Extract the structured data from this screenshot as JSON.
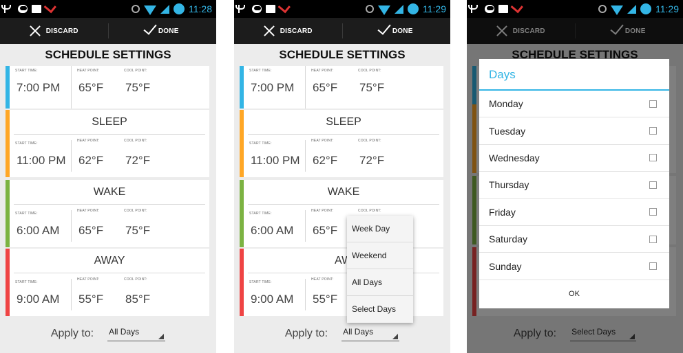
{
  "status": {
    "time1": "11:28",
    "time2": "11:29",
    "time3": "11:29"
  },
  "actionbar": {
    "discard_label": "DISCARD",
    "done_label": "DONE"
  },
  "title": "SCHEDULE SETTINGS",
  "labels": {
    "start_time": "START TIME:",
    "heat_point": "HEAT POINT:",
    "cool_point": "COOL POINT:"
  },
  "schedules": [
    {
      "name": "",
      "start": "7:00 PM",
      "heat": "65°F",
      "cool": "75°F",
      "color": "#33b5e5"
    },
    {
      "name": "SLEEP",
      "start": "11:00 PM",
      "heat": "62°F",
      "cool": "72°F",
      "color": "#ffa726"
    },
    {
      "name": "WAKE",
      "start": "6:00 AM",
      "heat": "65°F",
      "cool": "75°F",
      "color": "#7cb342"
    },
    {
      "name": "AWAY",
      "start": "9:00 AM",
      "heat": "55°F",
      "cool": "85°F",
      "color": "#ef4444"
    }
  ],
  "apply": {
    "label": "Apply to:",
    "value1": "All Days",
    "value2": "All Days",
    "value3": "Select Days"
  },
  "dropdown": {
    "options": [
      "Week Day",
      "Weekend",
      "All Days",
      "Select Days"
    ]
  },
  "dialog": {
    "title": "Days",
    "days": [
      "Monday",
      "Tuesday",
      "Wednesday",
      "Thursday",
      "Friday",
      "Saturday",
      "Sunday"
    ],
    "ok_label": "OK"
  }
}
